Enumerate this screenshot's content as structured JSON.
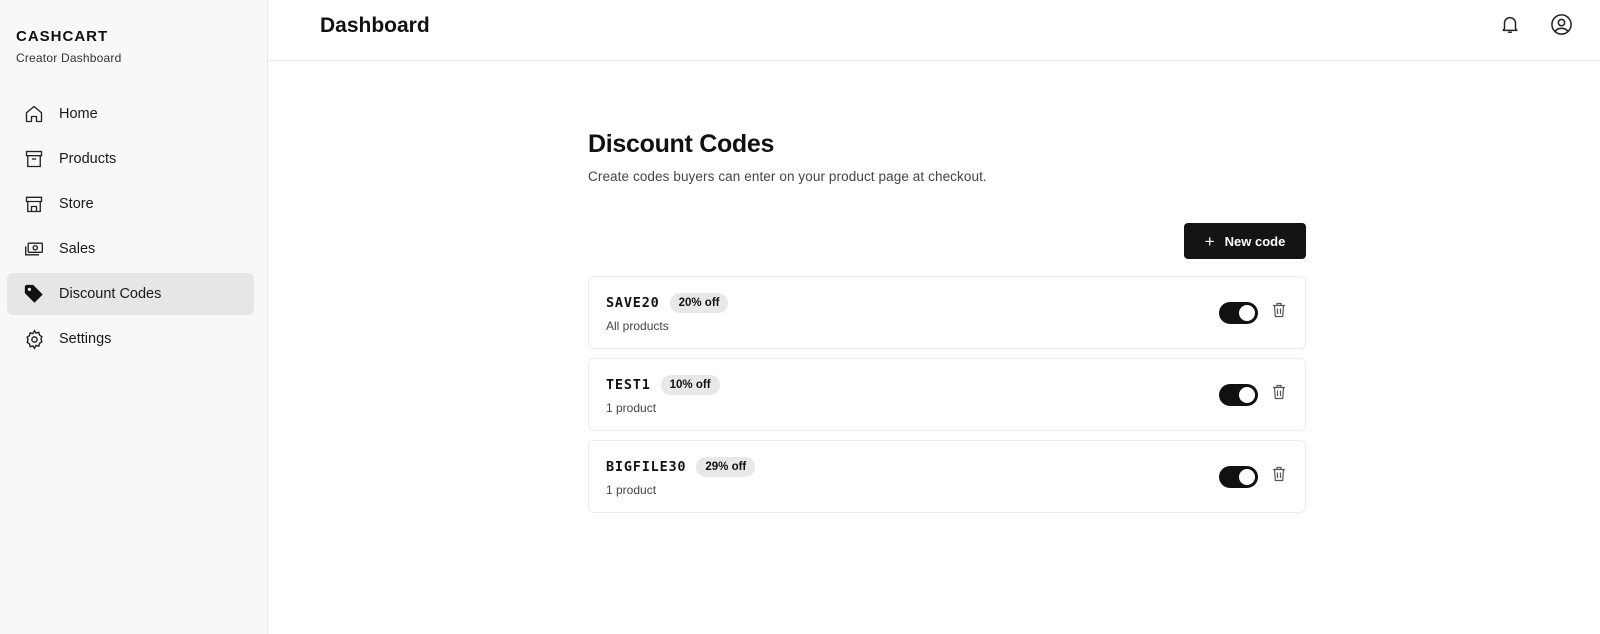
{
  "brand": {
    "name": "CASHCART",
    "subtitle": "Creator Dashboard"
  },
  "sidebar": {
    "items": [
      {
        "label": "Home",
        "icon": "home-icon",
        "active": false
      },
      {
        "label": "Products",
        "icon": "archive-box-icon",
        "active": false
      },
      {
        "label": "Store",
        "icon": "storefront-icon",
        "active": false
      },
      {
        "label": "Sales",
        "icon": "cash-icon",
        "active": false
      },
      {
        "label": "Discount Codes",
        "icon": "tag-icon",
        "active": true
      },
      {
        "label": "Settings",
        "icon": "gear-icon",
        "active": false
      }
    ]
  },
  "header": {
    "title": "Dashboard",
    "icons": [
      "bell-icon",
      "user-circle-icon"
    ]
  },
  "main": {
    "title": "Discount Codes",
    "description": "Create codes buyers can enter on your product page at checkout.",
    "new_button_label": "New code",
    "codes": [
      {
        "code": "SAVE20",
        "discount": "20% off",
        "scope": "All products",
        "enabled": true
      },
      {
        "code": "TEST1",
        "discount": "10% off",
        "scope": "1 product",
        "enabled": true
      },
      {
        "code": "BIGFILE30",
        "discount": "29% off",
        "scope": "1 product",
        "enabled": true
      }
    ]
  },
  "colors": {
    "accent": "#141414",
    "sidebar_bg": "#f8f8f8",
    "active_item_bg": "#e6e6e6",
    "badge_bg": "#e8e8e8"
  }
}
